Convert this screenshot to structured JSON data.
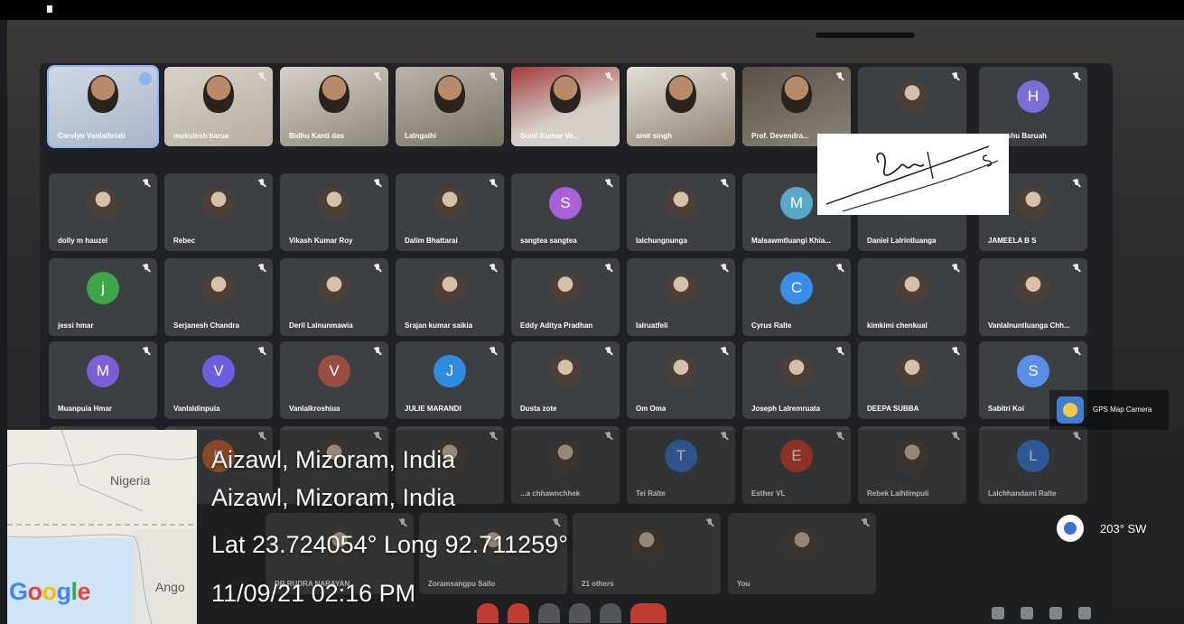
{
  "participants": {
    "row1": [
      {
        "name": "Carolyn Vanlalhriati",
        "speaking": true
      },
      {
        "name": "mukulesh barua"
      },
      {
        "name": "Bidhu Kanti das"
      },
      {
        "name": "Lalngaihi"
      },
      {
        "name": "Sunil Kumar Ve..."
      },
      {
        "name": "amit singh"
      },
      {
        "name": "Prof. Devendra..."
      },
      {
        "name": ""
      },
      {
        "name": "...angshu Baruah",
        "initial": "H",
        "color": "#7b6fd6"
      }
    ],
    "row2": [
      {
        "name": "dolly m hauzel"
      },
      {
        "name": "Rebec"
      },
      {
        "name": "Vikash Kumar Roy"
      },
      {
        "name": "Dalim Bhattarai"
      },
      {
        "name": "sangtea sangtea",
        "initial": "S",
        "color": "#a95fd6"
      },
      {
        "name": "lalchungnunga"
      },
      {
        "name": "Malsawmtluangi Khia...",
        "initial": "M",
        "color": "#5aa8c8"
      },
      {
        "name": "Daniel Lalrintluanga"
      },
      {
        "name": "JAMEELA B S"
      }
    ],
    "row3": [
      {
        "name": "jessi hmar",
        "initial": "j",
        "color": "#3ea548"
      },
      {
        "name": "Serjanesh Chandra"
      },
      {
        "name": "Deril Lalnunmawia"
      },
      {
        "name": "Srajan kumar saikia"
      },
      {
        "name": "Eddy Aditya Pradhan"
      },
      {
        "name": "lalruatfeli"
      },
      {
        "name": "Cyrus Ralte",
        "initial": "C",
        "color": "#3a8de8"
      },
      {
        "name": "kimkimi chenkual"
      },
      {
        "name": "Vanlalnuntluanga Chh..."
      }
    ],
    "row4": [
      {
        "name": "Muanpuia Hmar",
        "initial": "M",
        "color": "#7a5fd6"
      },
      {
        "name": "Vanlaldinpuia",
        "initial": "V",
        "color": "#6a5fe0"
      },
      {
        "name": "Vanlalkroshiua",
        "initial": "V",
        "color": "#9a4e42"
      },
      {
        "name": "JULIE MARANDI",
        "initial": "J",
        "color": "#2f8de0"
      },
      {
        "name": "Dusta zote"
      },
      {
        "name": "Om Oma"
      },
      {
        "name": "Joseph Lalremruata"
      },
      {
        "name": "DEEPA SUBBA"
      },
      {
        "name": "Sabitri Koi",
        "initial": "S",
        "color": "#5a8ee8"
      }
    ],
    "row5": [
      {
        "name": ""
      },
      {
        "name": "",
        "initial": "K",
        "color": "#c0602a"
      },
      {
        "name": ""
      },
      {
        "name": ""
      },
      {
        "name": "...a chhawnchhek"
      },
      {
        "name": "Tei Ralte",
        "initial": "T",
        "color": "#3a6fc8"
      },
      {
        "name": "Esther VL",
        "initial": "E",
        "color": "#c8402f"
      },
      {
        "name": "Rebek Lalhlimpuii"
      },
      {
        "name": "Lalchhandami Ralte",
        "initial": "L",
        "color": "#3a7ad8"
      }
    ],
    "row6": [
      {
        "name": "DR RUDRA NARAYAN"
      },
      {
        "name": "Zoramsangpu Sailo"
      },
      {
        "name": "21 others"
      },
      {
        "name": "You"
      }
    ]
  },
  "geotag": {
    "app_name": "GPS Map Camera",
    "map_labels": {
      "country1": "Nigeria",
      "country2": "Ango",
      "brand": "Google"
    },
    "line1": "Aizawl, Mizoram, India",
    "line2": "Aizawl, Mizoram, India",
    "line3": "Lat 23.724054° Long 92.711259°",
    "line4": "11/09/21 02:16 PM",
    "heading": "203° SW"
  },
  "colors": {
    "brand_blue": "#4285F4",
    "brand_red": "#EA4335",
    "brand_yellow": "#FBBC05",
    "brand_green": "#34A853",
    "tile_bg": "#3c4043"
  }
}
